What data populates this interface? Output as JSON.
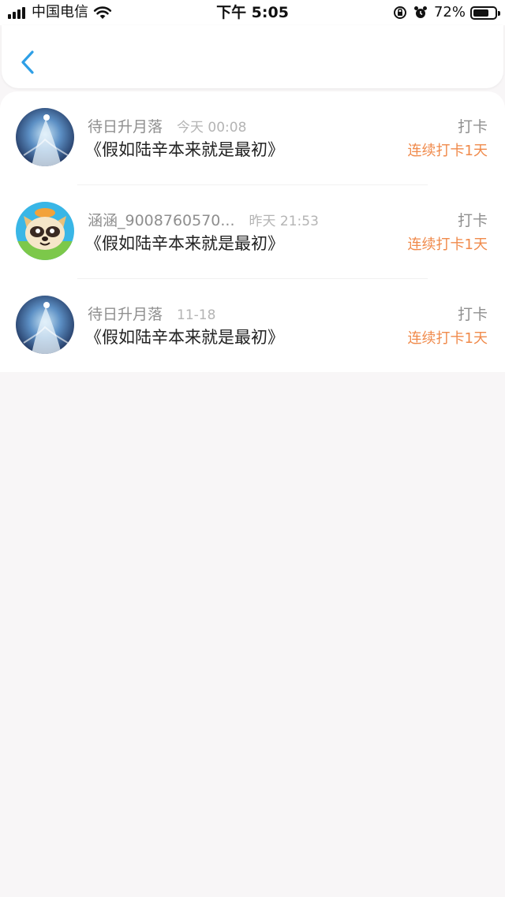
{
  "status_bar": {
    "carrier": "中国电信",
    "time": "下午 5:05",
    "battery_percent": "72%",
    "battery_level": 0.72
  },
  "nav": {
    "back_icon": "chevron-left-icon",
    "accent_color": "#2e9fe6"
  },
  "entries": [
    {
      "username": "待日升月落",
      "time": "今天 00:08",
      "book": "《假如陆辛本来就是最初》",
      "action": "打卡",
      "streak": "连续打卡1天",
      "avatar": "moonlit-figure-avatar"
    },
    {
      "username": "涵涵_9008760570...",
      "time": "昨天 21:53",
      "book": "《假如陆辛本来就是最初》",
      "action": "打卡",
      "streak": "连续打卡1天",
      "avatar": "cartoon-raccoon-avatar"
    },
    {
      "username": "待日升月落",
      "time": "11-18",
      "book": "《假如陆辛本来就是最初》",
      "action": "打卡",
      "streak": "连续打卡1天",
      "avatar": "moonlit-figure-avatar"
    }
  ],
  "colors": {
    "streak": "#f08a4b",
    "page_background": "#f8f6f7"
  }
}
